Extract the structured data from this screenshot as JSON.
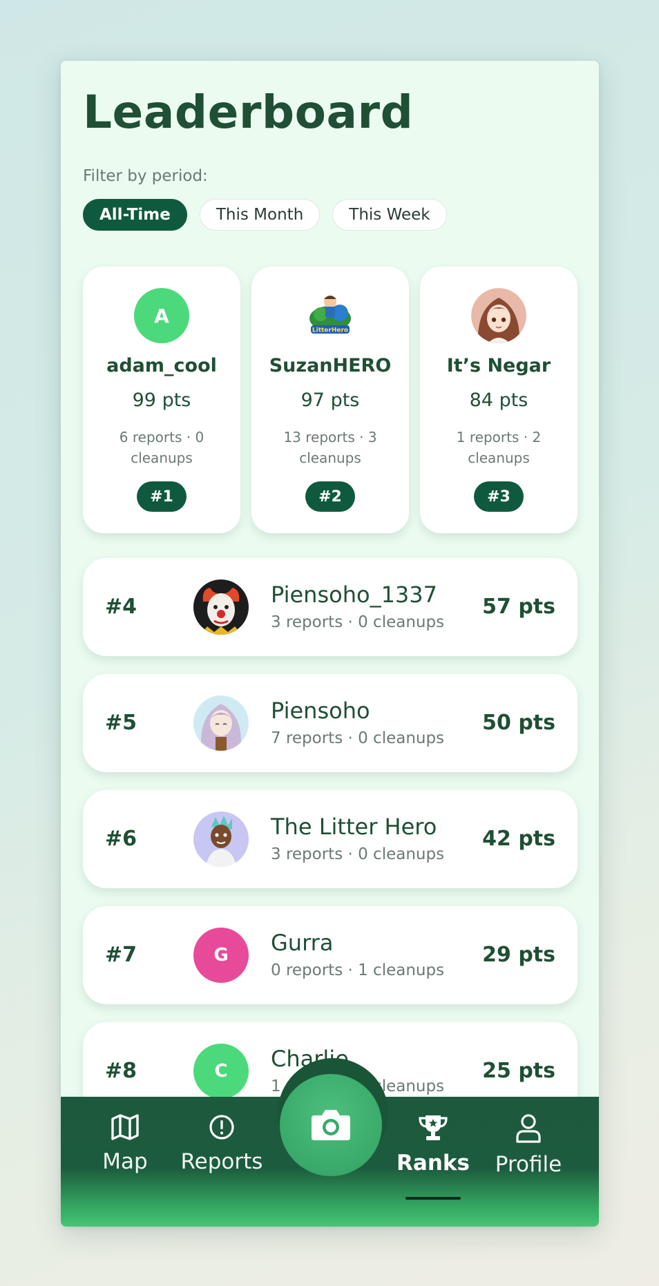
{
  "page": {
    "title": "Leaderboard",
    "filter_label": "Filter by period:"
  },
  "filters": [
    {
      "label": "All-Time",
      "active": true
    },
    {
      "label": "This Month",
      "active": false
    },
    {
      "label": "This Week",
      "active": false
    }
  ],
  "podium": [
    {
      "initial": "A",
      "avatar": "letter-avatar",
      "color": "#4cd97b",
      "name": "adam_cool",
      "points": "99 pts",
      "stats": "6 reports · 0 cleanups",
      "rank": "#1"
    },
    {
      "avatar": "litter-hero-logo",
      "name": "SuzanHERO",
      "points": "97 pts",
      "stats": "13 reports · 3 cleanups",
      "rank": "#2"
    },
    {
      "avatar": "anime-girl-portrait",
      "name": "It’s Negar",
      "points": "84 pts",
      "stats": "1 reports · 2 cleanups",
      "rank": "#3"
    }
  ],
  "list": [
    {
      "rank": "#4",
      "avatar": "clown-photo",
      "name": "Piensoho_1337",
      "stats": "3 reports · 0 cleanups",
      "points": "57 pts"
    },
    {
      "rank": "#5",
      "avatar": "anime-character-photo",
      "name": "Piensoho",
      "stats": "7 reports · 0 cleanups",
      "points": "50 pts"
    },
    {
      "rank": "#6",
      "avatar": "cartoon-avatar",
      "name": "The Litter Hero",
      "stats": "3 reports · 0 cleanups",
      "points": "42 pts"
    },
    {
      "rank": "#7",
      "initial": "G",
      "avatar": "letter-avatar",
      "color": "#e84a9a",
      "name": "Gurra",
      "stats": "0 reports · 1 cleanups",
      "points": "29 pts"
    },
    {
      "rank": "#8",
      "initial": "C",
      "avatar": "letter-avatar",
      "color": "#4cd97b",
      "name": "Charlie",
      "stats": "1 reports · 0 cleanups",
      "points": "25 pts"
    }
  ],
  "nav": {
    "items": [
      {
        "label": "Map",
        "icon": "map-icon",
        "active": false
      },
      {
        "label": "Reports",
        "icon": "alert-circle-icon",
        "active": false
      },
      {
        "label": "Ranks",
        "icon": "trophy-icon",
        "active": true
      },
      {
        "label": "Profile",
        "icon": "user-icon",
        "active": false
      }
    ],
    "center_action": "camera-icon"
  },
  "colors": {
    "brand_dark": "#0f5a3e",
    "text_green": "#1f4f34",
    "card_bg": "#ffffff",
    "page_bg": "#ebfbf0"
  }
}
